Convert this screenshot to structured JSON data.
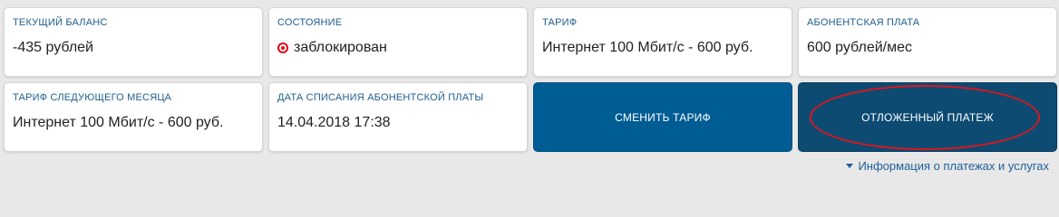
{
  "cards": {
    "balance": {
      "label": "Текущий баланс",
      "value": "-435 рублей"
    },
    "status": {
      "label": "Состояние",
      "value": "заблокирован",
      "icon": "blocked-status-icon",
      "icon_color": "#e30613"
    },
    "tariff": {
      "label": "Тариф",
      "value": "Интернет 100 Мбит/с - 600 руб."
    },
    "fee": {
      "label": "Абонентская плата",
      "value": "600 рублей/мес"
    },
    "next_tariff": {
      "label": "Тариф следующего месяца",
      "value": "Интернет 100 Мбит/с - 600 руб."
    },
    "charge_date": {
      "label": "Дата списания абонентской платы",
      "value": "14.04.2018 17:38"
    }
  },
  "buttons": {
    "change_tariff": {
      "label": "Сменить тариф",
      "color": "#005d94"
    },
    "deferred_payment": {
      "label": "Отложенный платеж",
      "color": "#0d4b72"
    }
  },
  "annotation": {
    "ellipse_color": "#e0141b"
  },
  "links": {
    "payments_info": {
      "label": "Информация о платежах и услугах",
      "color": "#1e5f99"
    }
  }
}
